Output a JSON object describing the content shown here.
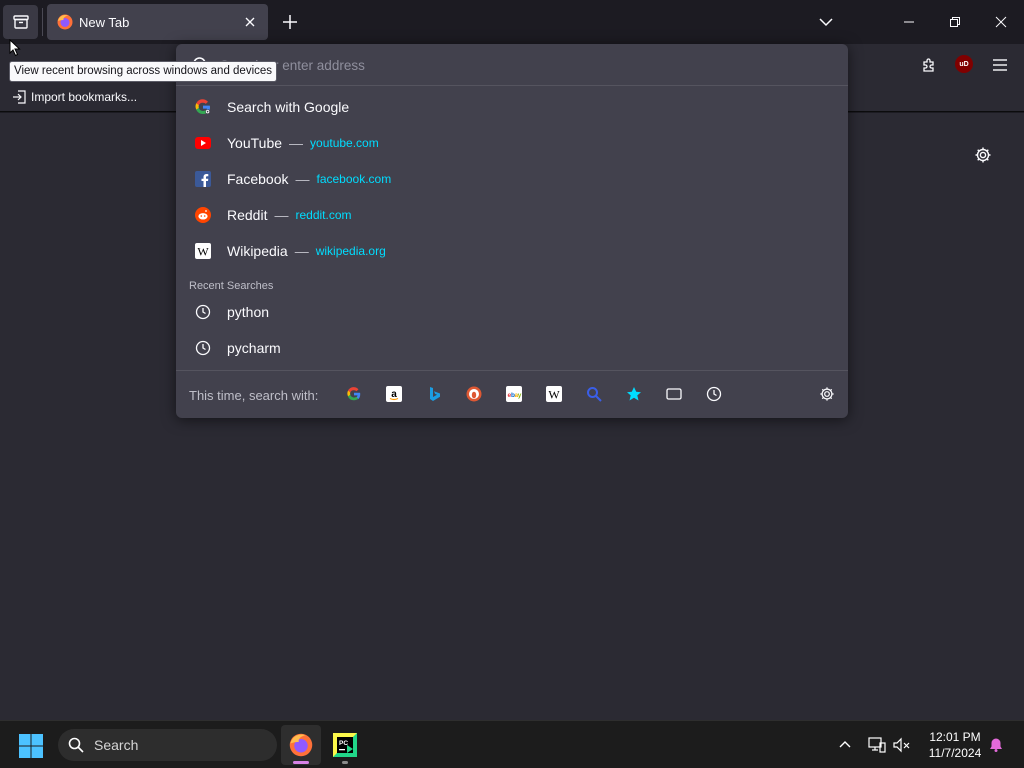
{
  "tabstrip": {
    "recent_tooltip": "View recent browsing across windows and devices",
    "tabs": [
      {
        "title": "New Tab"
      }
    ]
  },
  "bookmarks": {
    "import_label": "Import bookmarks..."
  },
  "urlbar": {
    "placeholder": "Search or enter address",
    "results": [
      {
        "title": "Search with Google",
        "url": "",
        "icon": "google-icon"
      },
      {
        "title": "YouTube",
        "dash": "—",
        "url": "youtube.com",
        "icon": "youtube-icon"
      },
      {
        "title": "Facebook",
        "dash": "—",
        "url": "facebook.com",
        "icon": "facebook-icon"
      },
      {
        "title": "Reddit",
        "dash": "—",
        "url": "reddit.com",
        "icon": "reddit-icon"
      },
      {
        "title": "Wikipedia",
        "dash": "—",
        "url": "wikipedia.org",
        "icon": "wikipedia-icon"
      }
    ],
    "recent_searches_label": "Recent Searches",
    "recent_searches": [
      {
        "title": "python",
        "icon": "history-clock-icon"
      },
      {
        "title": "pycharm",
        "icon": "history-clock-icon"
      }
    ],
    "oneoff_label": "This time, search with:",
    "oneoff_engines": [
      "Google",
      "Amazon",
      "Bing",
      "DuckDuckGo",
      "eBay",
      "Wikipedia",
      "Search",
      "Bookmarks",
      "Tabs",
      "History"
    ]
  },
  "taskbar": {
    "search_label": "Search",
    "time": "12:01 PM",
    "date": "11/7/2024"
  },
  "colors": {
    "accent_url": "#00ddff",
    "content_bg": "#2b2a33",
    "popup_bg": "#42414d"
  }
}
